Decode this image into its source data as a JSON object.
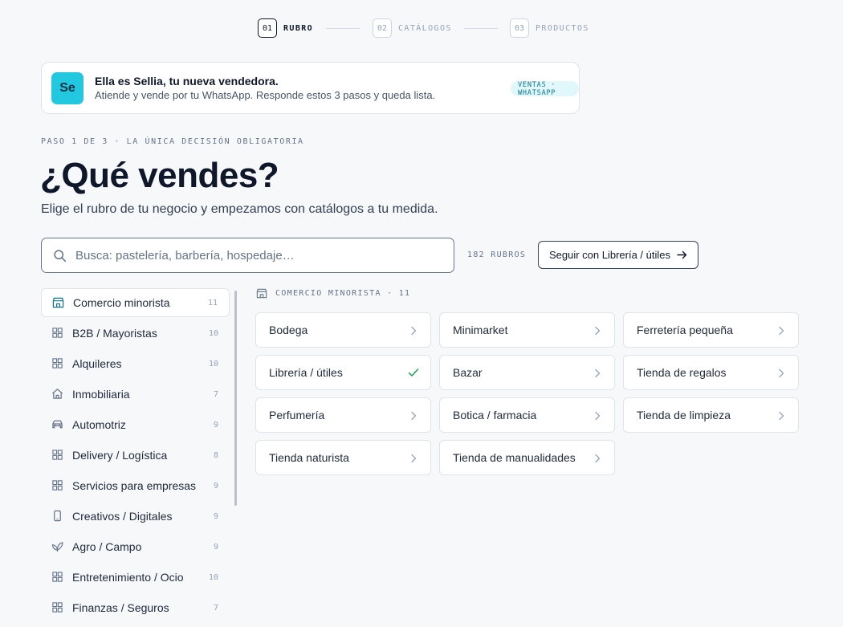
{
  "stepper": {
    "steps": [
      {
        "num": "01",
        "label": "RUBRO"
      },
      {
        "num": "02",
        "label": "CATÁLOGOS"
      },
      {
        "num": "03",
        "label": "PRODUCTOS"
      }
    ]
  },
  "banner": {
    "avatar": "Se",
    "title": "Ella es Sellia, tu nueva vendedora.",
    "subtitle": "Atiende y vende por tu WhatsApp. Responde estos 3 pasos y queda lista.",
    "tag": "VENTAS · WHATSAPP"
  },
  "intro": {
    "kicker": "PASO 1 DE 3 · LA ÚNICA DECISIÓN OBLIGATORIA",
    "title": "¿Qué vendes?",
    "subtitle": "Elige el rubro de tu negocio y empezamos con catálogos a tu medida."
  },
  "search": {
    "placeholder": "Busca: pastelería, barbería, hospedaje…",
    "count_label": "182 RUBROS",
    "continue_label": "Seguir con Librería / útiles"
  },
  "sidebar": {
    "items": [
      {
        "label": "Comercio minorista",
        "count": "11",
        "icon": "store-icon"
      },
      {
        "label": "B2B / Mayoristas",
        "count": "10",
        "icon": "grid-icon"
      },
      {
        "label": "Alquileres",
        "count": "10",
        "icon": "grid-icon"
      },
      {
        "label": "Inmobiliaria",
        "count": "7",
        "icon": "house-icon"
      },
      {
        "label": "Automotriz",
        "count": "9",
        "icon": "car-icon"
      },
      {
        "label": "Delivery / Logística",
        "count": "8",
        "icon": "grid-icon"
      },
      {
        "label": "Servicios para empresas",
        "count": "9",
        "icon": "grid-icon"
      },
      {
        "label": "Creativos / Digitales",
        "count": "9",
        "icon": "phone-icon"
      },
      {
        "label": "Agro / Campo",
        "count": "9",
        "icon": "leaf-icon"
      },
      {
        "label": "Entretenimiento / Ocio",
        "count": "10",
        "icon": "grid-icon"
      },
      {
        "label": "Finanzas / Seguros",
        "count": "7",
        "icon": "grid-icon"
      }
    ]
  },
  "section": {
    "label": "COMERCIO MINORISTA · 11",
    "icon": "store-icon"
  },
  "products": [
    {
      "name": "Bodega",
      "state": "chevron"
    },
    {
      "name": "Minimarket",
      "state": "chevron"
    },
    {
      "name": "Ferretería pequeña",
      "state": "chevron"
    },
    {
      "name": "Librería / útiles",
      "state": "selected"
    },
    {
      "name": "Bazar",
      "state": "chevron"
    },
    {
      "name": "Tienda de regalos",
      "state": "chevron"
    },
    {
      "name": "Perfumería",
      "state": "chevron"
    },
    {
      "name": "Botica / farmacia",
      "state": "chevron"
    },
    {
      "name": "Tienda de limpieza",
      "state": "chevron"
    },
    {
      "name": "Tienda naturista",
      "state": "chevron"
    },
    {
      "name": "Tienda de manualidades",
      "state": "chevron"
    }
  ],
  "colors": {
    "accent": "#22c7e0",
    "check": "#16a34a",
    "text": "#0f172a",
    "muted": "#64748b"
  }
}
